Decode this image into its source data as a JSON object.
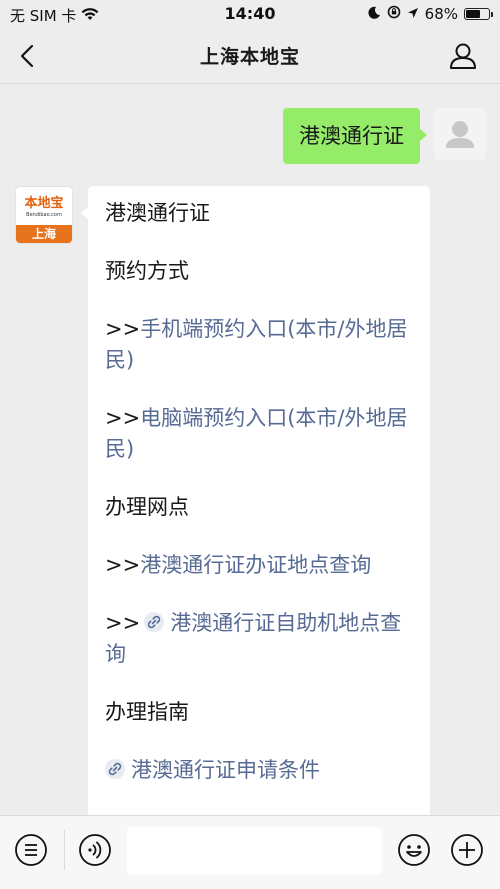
{
  "status_bar": {
    "carrier": "无 SIM 卡",
    "time": "14:40",
    "battery_percent_text": "68%",
    "battery_level": 0.68
  },
  "nav": {
    "title": "上海本地宝"
  },
  "outgoing_message": {
    "text": "港澳通行证"
  },
  "bot_avatar": {
    "brand": "本地宝",
    "url": "Bendibao.com",
    "city": "上海"
  },
  "incoming_message": {
    "heading": "港澳通行证",
    "section_booking": "预约方式",
    "link_mobile_prefix": ">>",
    "link_mobile": "手机端预约入口(本市/外地居民)",
    "link_pc_prefix": ">>",
    "link_pc": "电脑端预约入口(本市/外地居民)",
    "section_locations": "办理网点",
    "link_office_prefix": ">>",
    "link_office": "港澳通行证办证地点查询",
    "link_machine_prefix": ">>",
    "link_machine": "港澳通行证自助机地点查询",
    "section_guide": "办理指南",
    "link_conditions": "港澳通行证申请条件"
  },
  "input_bar": {
    "input_value": ""
  },
  "colors": {
    "outgoing_bubble": "#95ec69",
    "link": "#576b95",
    "background": "#ededed",
    "brand_orange": "#e8731d"
  }
}
